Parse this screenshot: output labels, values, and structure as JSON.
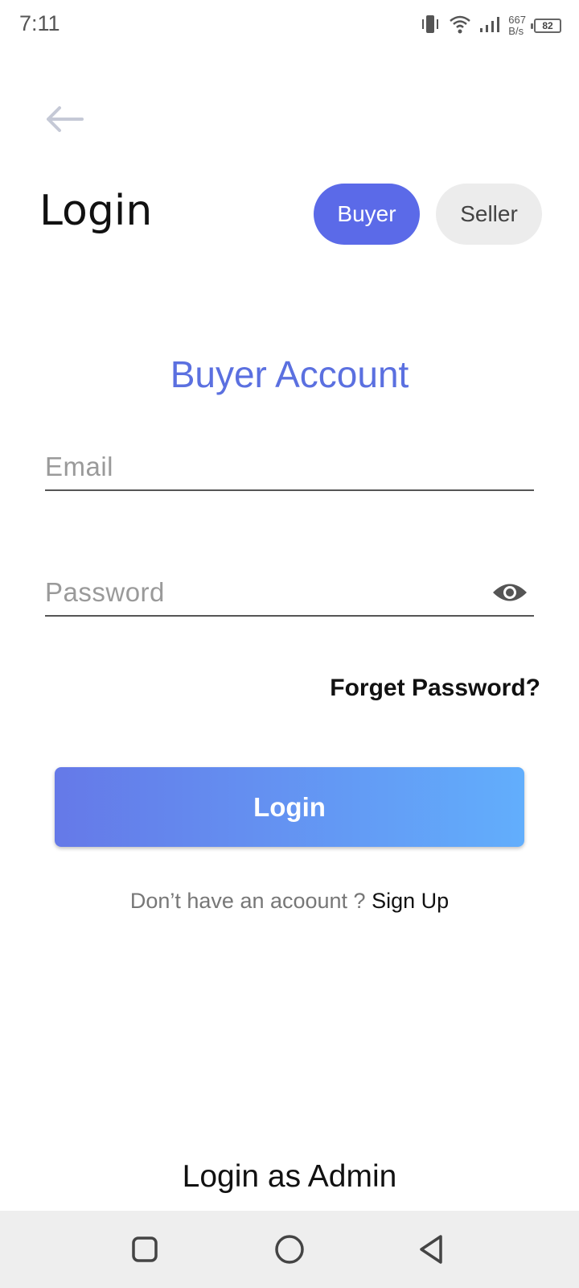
{
  "status_bar": {
    "time": "7:11",
    "net_speed_value": "667",
    "net_speed_unit": "B/s",
    "battery": "82"
  },
  "header": {
    "title": "Login",
    "roles": {
      "buyer": "Buyer",
      "seller": "Seller",
      "selected": "Buyer"
    }
  },
  "form": {
    "heading": "Buyer Account",
    "email_placeholder": "Email",
    "password_placeholder": "Password",
    "forget_password": "Forget Password?",
    "login_button": "Login"
  },
  "signup": {
    "prompt": "Don’t have an acoount ? ",
    "link": "Sign Up"
  },
  "admin_link": "Login as Admin",
  "colors": {
    "accent": "#5b6ae8",
    "heading": "#5b70e0",
    "button_gradient_start": "#6579e8",
    "button_gradient_end": "#62aefc"
  },
  "icons": [
    "vibrate-icon",
    "wifi-icon",
    "signal-icon",
    "battery-icon",
    "back-arrow-icon",
    "eye-icon",
    "recents-nav-icon",
    "home-nav-icon",
    "back-nav-icon"
  ]
}
